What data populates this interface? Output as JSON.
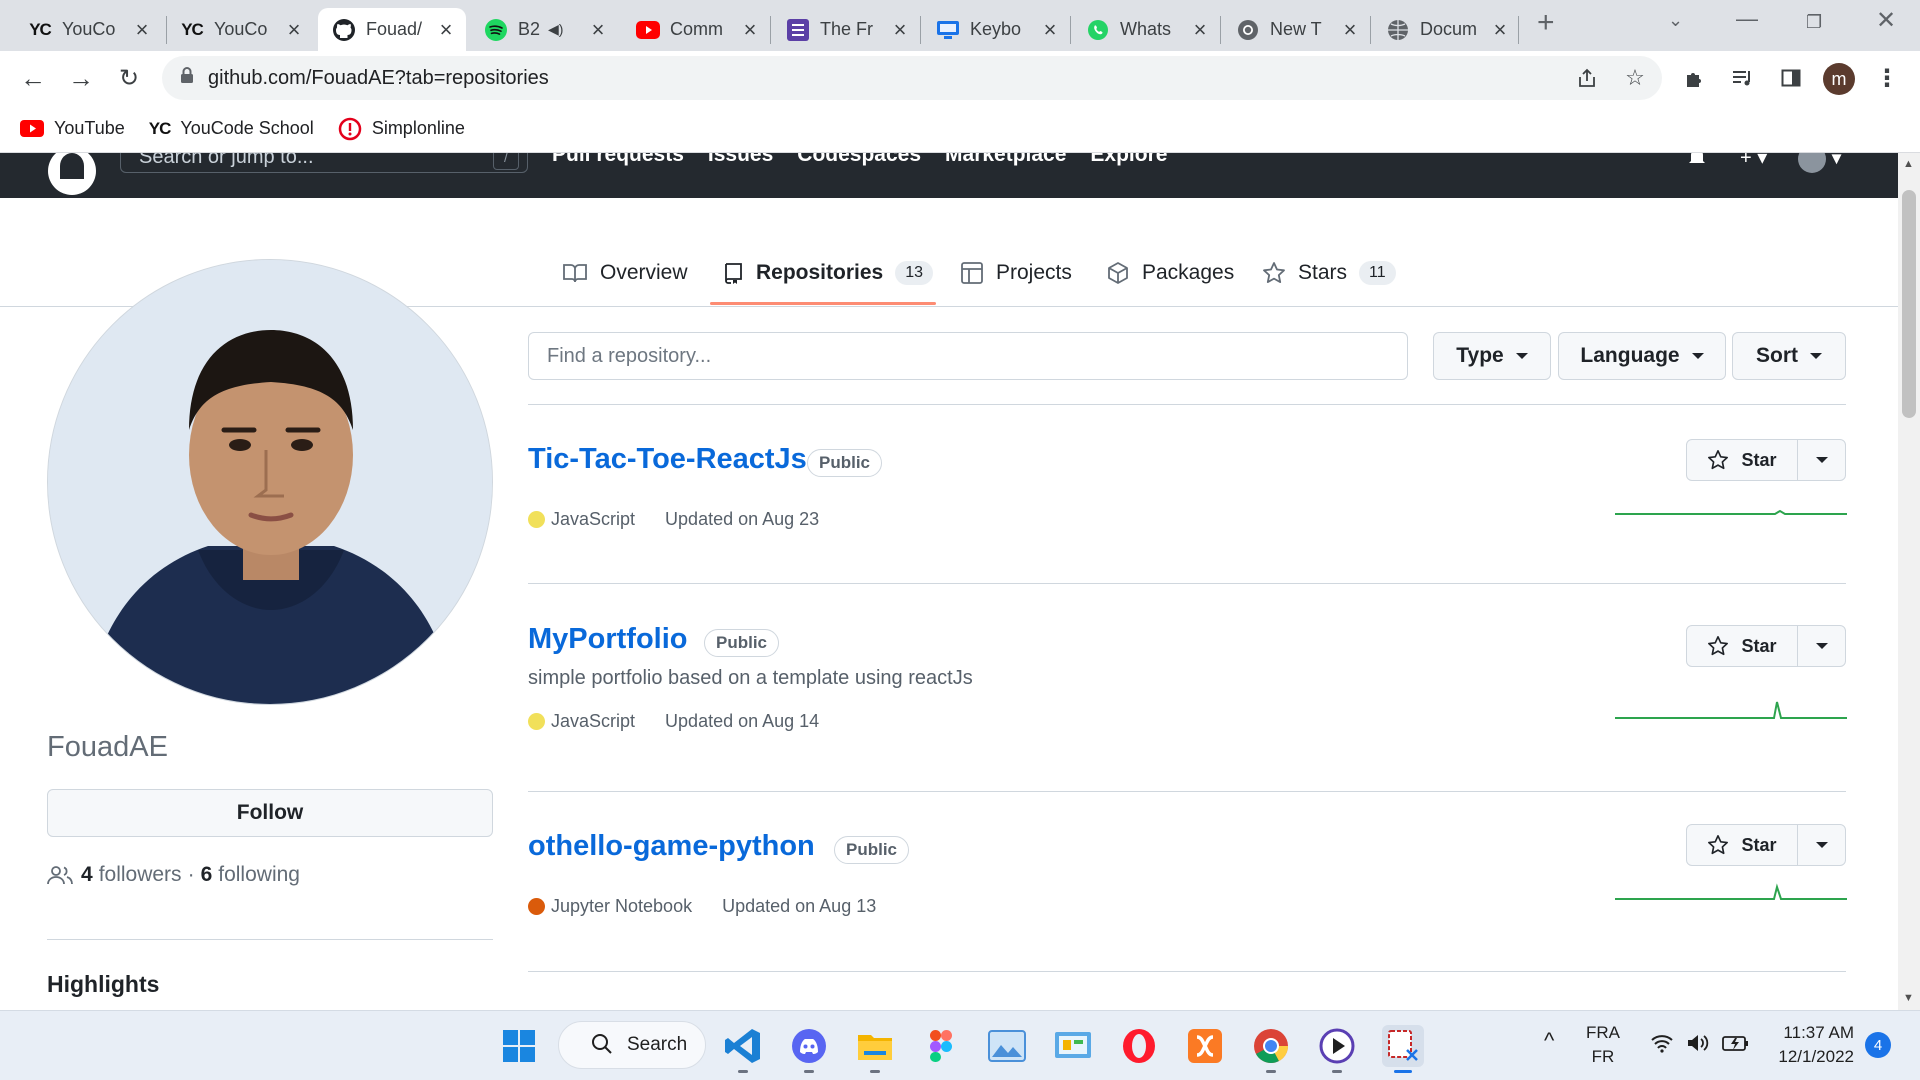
{
  "browser": {
    "tabs": [
      {
        "label": "YouCo",
        "icon": "youcode-icon"
      },
      {
        "label": "YouCo",
        "icon": "youcode-icon"
      },
      {
        "label": "Fouad/",
        "icon": "github-icon"
      },
      {
        "label": "B2",
        "icon": "spotify-icon"
      },
      {
        "label": "Comm",
        "icon": "youtube-icon"
      },
      {
        "label": "The Fr",
        "icon": "notion-icon"
      },
      {
        "label": "Keybo",
        "icon": "monitor-icon"
      },
      {
        "label": "Whats",
        "icon": "whatsapp-icon"
      },
      {
        "label": "New T",
        "icon": "chrome-icon"
      },
      {
        "label": "Docum",
        "icon": "globe-icon"
      }
    ],
    "yc_logo_text": "YC",
    "url": "github.com/FouadAE?tab=repositories",
    "profile_initial": "m",
    "bookmarks": [
      {
        "label": "YouTube",
        "icon": "youtube-icon"
      },
      {
        "label": "YouCode School",
        "icon": "youcode-icon"
      },
      {
        "label": "Simplonline",
        "icon": "simplon-icon"
      }
    ]
  },
  "github_header": {
    "search_placeholder": "Search or jump to...",
    "search_shortcut": "/",
    "nav": [
      "Pull requests",
      "Issues",
      "Codespaces",
      "Marketplace",
      "Explore"
    ]
  },
  "profile_tabs": {
    "overview": "Overview",
    "repositories": "Repositories",
    "repositories_count": "13",
    "projects": "Projects",
    "packages": "Packages",
    "stars": "Stars",
    "stars_count": "11"
  },
  "profile": {
    "username": "FouadAE",
    "follow_label": "Follow",
    "followers_count": "4",
    "followers_label": "followers",
    "separator": "·",
    "following_count": "6",
    "following_label": "following",
    "highlights_title": "Highlights"
  },
  "repo_filters": {
    "search_placeholder": "Find a repository...",
    "type_label": "Type",
    "language_label": "Language",
    "sort_label": "Sort"
  },
  "repositories": [
    {
      "name": "Tic-Tac-Toe-ReactJs",
      "visibility": "Public",
      "description": "",
      "language": "JavaScript",
      "language_color": "#f1e05a",
      "updated": "Updated on Aug 23",
      "star_label": "Star"
    },
    {
      "name": "MyPortfolio",
      "visibility": "Public",
      "description": "simple portfolio based on a template using reactJs",
      "language": "JavaScript",
      "language_color": "#f1e05a",
      "updated": "Updated on Aug 14",
      "star_label": "Star"
    },
    {
      "name": "othello-game-python",
      "visibility": "Public",
      "description": "",
      "language": "Jupyter Notebook",
      "language_color": "#da5b0b",
      "updated": "Updated on Aug 13",
      "star_label": "Star"
    }
  ],
  "taskbar": {
    "search_label": "Search",
    "lang_top": "FRA",
    "lang_bottom": "FR",
    "time": "11:37 AM",
    "date": "12/1/2022",
    "notification_count": "4"
  },
  "colors": {
    "link": "#0969da",
    "header_bg": "#24292f",
    "tab_underline": "#fd8c73",
    "sparkline": "#2da44e"
  }
}
